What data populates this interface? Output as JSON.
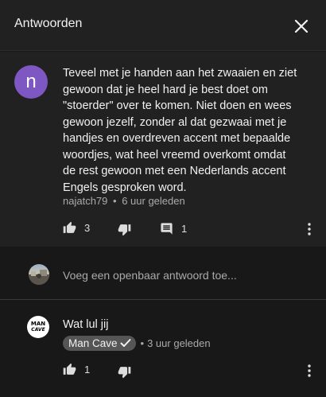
{
  "header": {
    "title": "Antwoorden",
    "close_icon": "close-icon"
  },
  "comment": {
    "avatar_letter": "n",
    "avatar_color": "#7e57c2",
    "text": "Teveel met je handen aan het zwaaien en ziet gewoon dat je heel hard je best doet om \"stoerder\" over te komen. Niet doen en wees gewoon jezelf, zonder al dat gezwaai met je handjes en overdreven accent met bepaalde woordjes, wat heel vreemd overkomt omdat de rest gewoon met een Nederlands accent Engels gesproken word.",
    "author": "najatch79",
    "separator": "•",
    "time": "6 uur geleden",
    "likes": "3",
    "replies": "1",
    "icons": [
      "thumb-up-icon",
      "thumb-down-icon",
      "comment-icon",
      "more-vert-icon"
    ]
  },
  "reply_box": {
    "placeholder": "Voeg een openbaar antwoord toe..."
  },
  "reply": {
    "avatar_line1": "MAN",
    "avatar_line2": "CAVE",
    "text": "Wat lul jij",
    "author": "Man Cave",
    "verified_icon": "checkmark-icon",
    "separator": "•",
    "time": "3 uur geleden",
    "likes": "1",
    "icons": [
      "thumb-up-icon",
      "thumb-down-icon",
      "more-vert-icon"
    ]
  },
  "colors": {
    "background": "#181818",
    "surface": "#212121",
    "text": "#f1f1f1",
    "secondary_text": "#aaaaaa",
    "badge": "#555555"
  }
}
